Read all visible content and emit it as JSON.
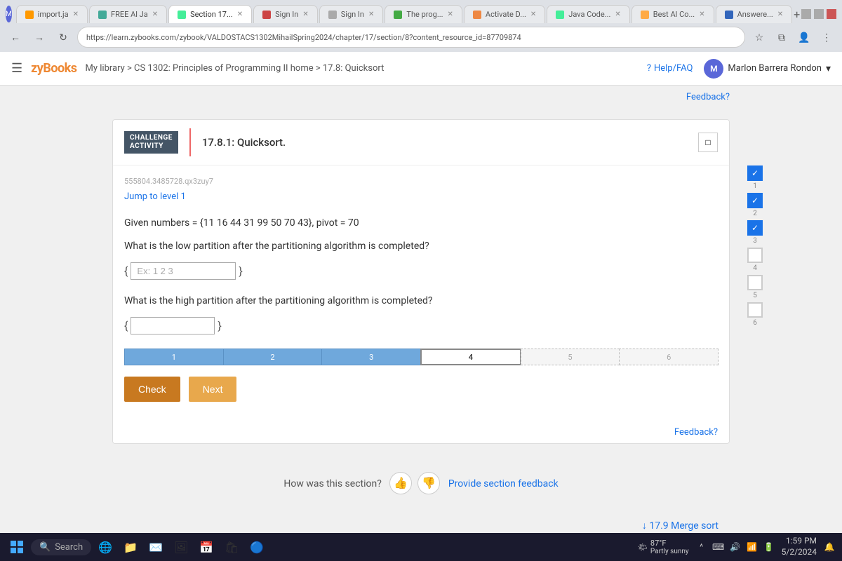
{
  "browser": {
    "tabs": [
      {
        "id": "tab1",
        "label": "import.ja",
        "favicon_color": "#f90",
        "active": false
      },
      {
        "id": "tab2",
        "label": "FREE Al Ja",
        "favicon_color": "#4a9",
        "active": false
      },
      {
        "id": "tab3",
        "label": "Section 17",
        "favicon_color": "#4e9",
        "active": true
      },
      {
        "id": "tab4",
        "label": "Sign In",
        "favicon_color": "#c44",
        "active": false
      },
      {
        "id": "tab5",
        "label": "Sign In",
        "favicon_color": "#aaa",
        "active": false
      },
      {
        "id": "tab6",
        "label": "The prog",
        "favicon_color": "#4a4",
        "active": false
      },
      {
        "id": "tab7",
        "label": "Activate D",
        "favicon_color": "#e84",
        "active": false
      },
      {
        "id": "tab8",
        "label": "Java Code",
        "favicon_color": "#4e9",
        "active": false
      },
      {
        "id": "tab9",
        "label": "Best Al Co",
        "favicon_color": "#fa4",
        "active": false
      },
      {
        "id": "tab10",
        "label": "Answere",
        "favicon_color": "#36b",
        "active": false
      }
    ],
    "address": "https://learn.zybooks.com/zybook/VALDOSTACS1302MihailSpring2024/chapter/17/section/8?content_resource_id=87709874"
  },
  "header": {
    "logo": "zyBooks",
    "breadcrumb": "My library > CS 1302: Principles of Programming II home > 17.8: Quicksort",
    "help_label": "Help/FAQ",
    "user_name": "Marlon Barrera Rondon"
  },
  "feedback_top": "Feedback?",
  "challenge": {
    "badge_line1": "CHALLENGE",
    "badge_line2": "ACTIVITY",
    "title": "17.8.1: Quicksort.",
    "activity_id": "555804.3485728.qx3zuy7",
    "jump_link": "Jump to level 1",
    "question1": "Given numbers = {11 16 44 31 99 50 70 43}, pivot = 70",
    "question2": "What is the low partition after the partitioning algorithm is completed?",
    "input1_placeholder": "Ex: 1 2 3",
    "input1_value": "",
    "question3": "What is the high partition after the partitioning algorithm is completed?",
    "input2_value": "",
    "progress_segments": [
      {
        "label": "1",
        "state": "completed"
      },
      {
        "label": "2",
        "state": "completed"
      },
      {
        "label": "3",
        "state": "completed"
      },
      {
        "label": "4",
        "state": "active"
      },
      {
        "label": "5",
        "state": "dotted"
      },
      {
        "label": "6",
        "state": "dotted"
      }
    ],
    "check_label": "Check",
    "next_label": "Next",
    "levels": [
      {
        "num": "1",
        "checked": true
      },
      {
        "num": "2",
        "checked": true
      },
      {
        "num": "3",
        "checked": true
      },
      {
        "num": "4",
        "checked": false
      },
      {
        "num": "5",
        "checked": false
      },
      {
        "num": "6",
        "checked": false
      }
    ]
  },
  "feedback_bottom": "Feedback?",
  "section_feedback": {
    "question": "How was this section?",
    "provide_link": "Provide section feedback"
  },
  "next_section": "↓ 17.9 Merge sort",
  "taskbar": {
    "search_placeholder": "Search",
    "time": "1:59 PM",
    "date": "5/2/2024",
    "weather_temp": "87°F",
    "weather_desc": "Partly sunny"
  }
}
